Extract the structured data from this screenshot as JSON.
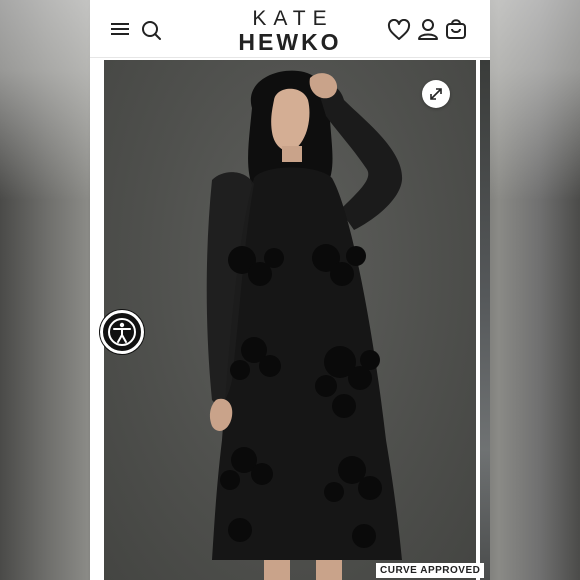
{
  "header": {
    "logo_line1": "KATE",
    "logo_line2": "HEWKO",
    "icons": [
      "menu-icon",
      "search-icon",
      "heart-icon",
      "user-icon",
      "cart-icon"
    ]
  },
  "gallery": {
    "badge": "CURVE APPROVED",
    "expand_icon": "expand-icon"
  },
  "accessibility": {
    "icon": "accessibility-icon"
  },
  "colors": {
    "header_bg": "#ffffff",
    "text": "#222222",
    "photo_bg": "#4f504d",
    "dress": "#151515"
  }
}
